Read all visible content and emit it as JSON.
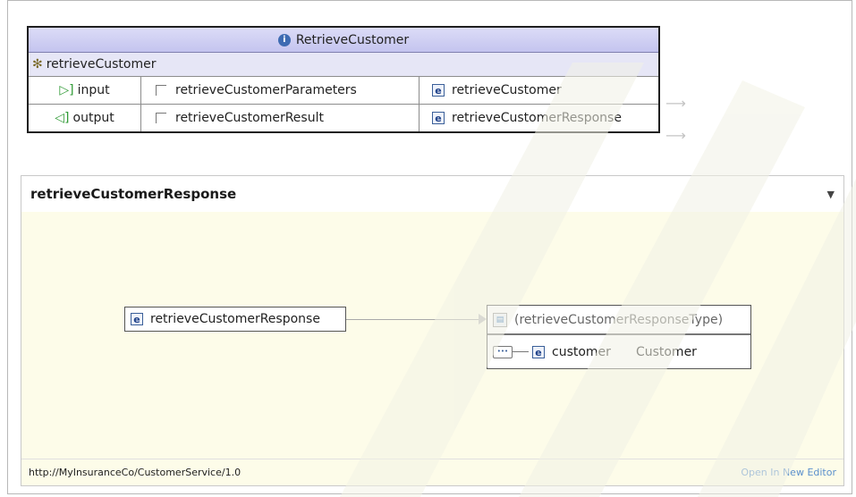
{
  "interface": {
    "name": "RetrieveCustomer",
    "operation": "retrieveCustomer",
    "rows": [
      {
        "direction": "input",
        "param": "retrieveCustomerParameters",
        "element": "retrieveCustomer"
      },
      {
        "direction": "output",
        "param": "retrieveCustomerResult",
        "element": "retrieveCustomerResponse"
      }
    ]
  },
  "editor": {
    "title": "retrieveCustomerResponse",
    "element_label": "retrieveCustomerResponse",
    "type_label": "(retrieveCustomerResponseType)",
    "child_name": "customer",
    "child_type": "Customer",
    "namespace": "http://MyInsuranceCo/CustomerService/1.0",
    "open_link": "Open In New Editor"
  },
  "icons": {
    "interface": "interface-icon",
    "operation": "operation-gear-icon",
    "element": "element-e-icon",
    "sequence": "sequence-icon"
  }
}
